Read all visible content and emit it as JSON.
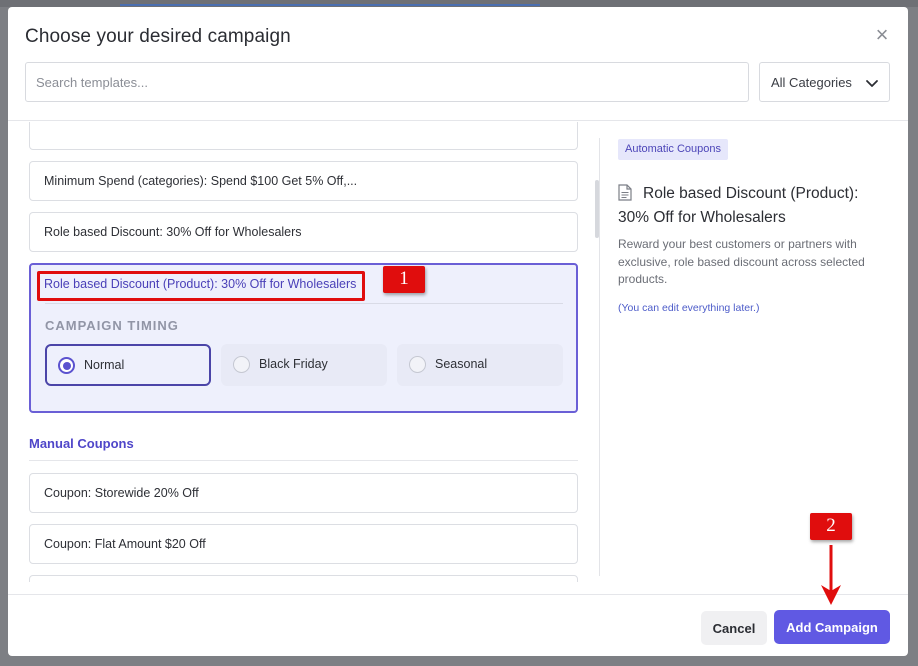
{
  "modal": {
    "title": "Choose your desired campaign",
    "close_symbol": "×"
  },
  "search": {
    "placeholder": "Search templates...",
    "value": ""
  },
  "category_filter": {
    "selected": "All Categories"
  },
  "templates": {
    "items": [
      {
        "label": "Minimum Spend (categories): Spend $100 Get 5% Off,..."
      },
      {
        "label": "Role based Discount: 30% Off for Wholesalers"
      }
    ],
    "selected": {
      "label": "Role based Discount (Product): 30% Off for Wholesalers",
      "timing_heading": "CAMPAIGN TIMING",
      "timing_options": [
        {
          "label": "Normal",
          "checked": true
        },
        {
          "label": "Black Friday",
          "checked": false
        },
        {
          "label": "Seasonal",
          "checked": false
        }
      ]
    },
    "manual_section": {
      "heading": "Manual Coupons",
      "items": [
        {
          "label": "Coupon: Storewide 20% Off"
        },
        {
          "label": "Coupon: Flat Amount $20 Off"
        }
      ]
    }
  },
  "detail": {
    "badge": "Automatic Coupons",
    "title": "Role based Discount (Product): 30% Off for Wholesalers",
    "description": "Reward your best customers or partners with exclusive, role based discount across selected products.",
    "note": "(You can edit everything later.)"
  },
  "footer": {
    "cancel_label": "Cancel",
    "add_label": "Add Campaign"
  },
  "annotations": {
    "step1": "1",
    "step2": "2"
  },
  "colors": {
    "accent": "#6059e3",
    "selected_border": "#6a5fd6",
    "annotation_red": "#e00d0d",
    "section_heading": "#4f46c9"
  },
  "icons": {
    "close": "close-icon",
    "dropdown": "chevron-down-icon",
    "document": "document-icon",
    "arrow": "arrow-down-icon"
  }
}
